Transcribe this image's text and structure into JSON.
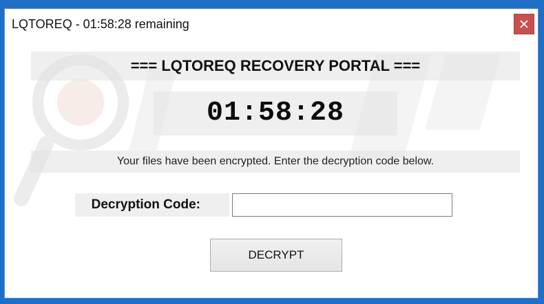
{
  "window": {
    "title": "LQTOREQ - 01:58:28 remaining",
    "close_icon": "close-icon"
  },
  "portal": {
    "header": "=== LQTOREQ RECOVERY PORTAL ===",
    "timer": "01:58:28",
    "message": "Your files have been encrypted.  Enter the decryption code below.",
    "code_label": "Decryption Code:",
    "code_value": "",
    "decrypt_label": "DECRYPT"
  },
  "colors": {
    "close_button": "#c75050",
    "desktop_border": "#1f6fc7"
  }
}
